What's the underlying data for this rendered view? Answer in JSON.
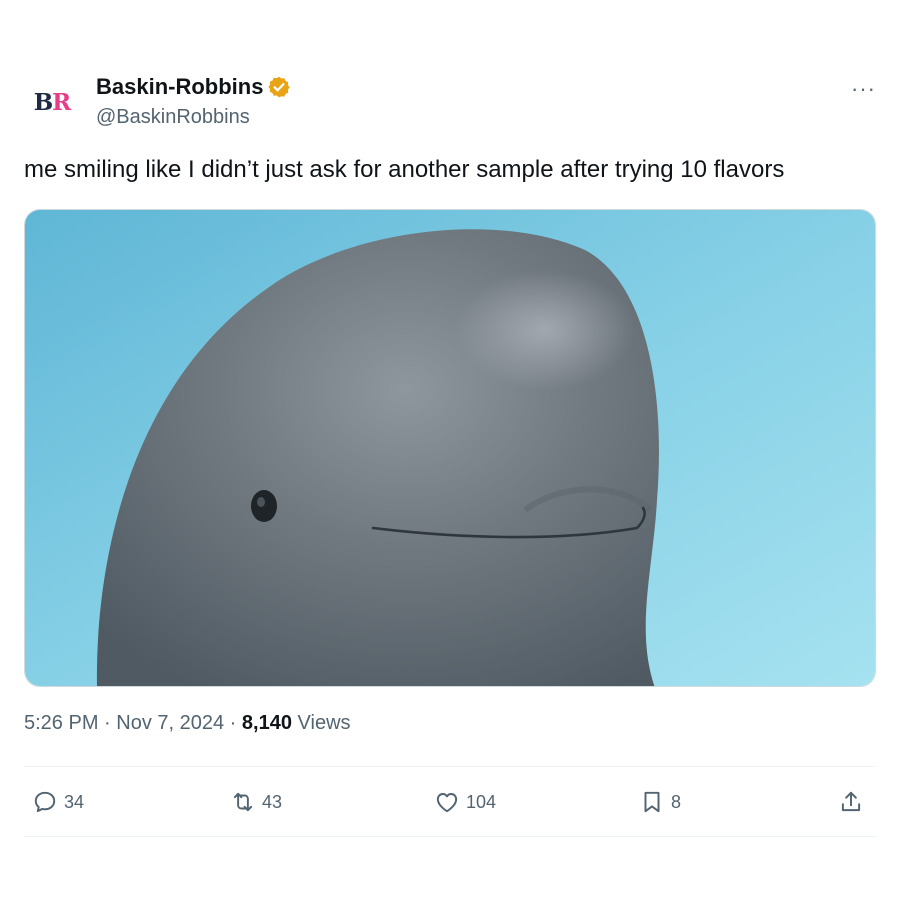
{
  "author": {
    "display_name": "Baskin-Robbins",
    "handle": "@BaskinRobbins",
    "avatar_letters": {
      "first": "B",
      "second": "R"
    },
    "verified_icon": "verified-badge-icon",
    "verified_color": "#e8a316"
  },
  "more_label": "···",
  "tweet": {
    "text": "me smiling like I didn’t just ask for another sample after trying 10 flavors"
  },
  "media": {
    "icon": "beluga-whale-photo",
    "background_color": "#7fcbe0"
  },
  "meta": {
    "time": "5:26 PM",
    "sep1": " · ",
    "date": "Nov 7, 2024",
    "sep2": " · ",
    "views_count": "8,140",
    "views_label": " Views"
  },
  "actions": {
    "reply": {
      "icon": "reply-icon",
      "count": "34"
    },
    "repost": {
      "icon": "repost-icon",
      "count": "43"
    },
    "like": {
      "icon": "heart-icon",
      "count": "104"
    },
    "bookmark": {
      "icon": "bookmark-icon",
      "count": "8"
    },
    "share": {
      "icon": "share-icon"
    }
  }
}
